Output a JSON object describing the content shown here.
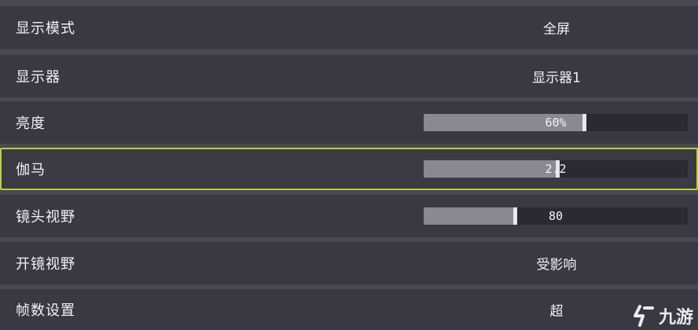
{
  "settings": {
    "rows": [
      {
        "label": "显示模式",
        "type": "value",
        "value": "全屏"
      },
      {
        "label": "显示器",
        "type": "value",
        "value": "显示器1"
      },
      {
        "label": "亮度",
        "type": "slider",
        "value_text": "60%",
        "fill_fraction": 0.6
      },
      {
        "label": "伽马",
        "type": "slider",
        "value_text": "2.2",
        "fill_fraction": 0.5,
        "selected": true
      },
      {
        "label": "镜头视野",
        "type": "slider",
        "value_text": "80",
        "fill_fraction": 0.34
      },
      {
        "label": "开镜视野",
        "type": "value",
        "value": "受影响"
      },
      {
        "label": "帧数设置",
        "type": "value",
        "value": "超"
      }
    ]
  },
  "watermark": {
    "text": "九游",
    "icon": "jiuyou-logo-icon"
  },
  "colors": {
    "background": "#4a4853",
    "row_background": "#3a3842",
    "selected_border": "#b6d239",
    "slider_track": "#2b2a32",
    "slider_fill": "#8a8892",
    "slider_thumb": "#e8e8ec",
    "text": "#f2f2f4"
  }
}
